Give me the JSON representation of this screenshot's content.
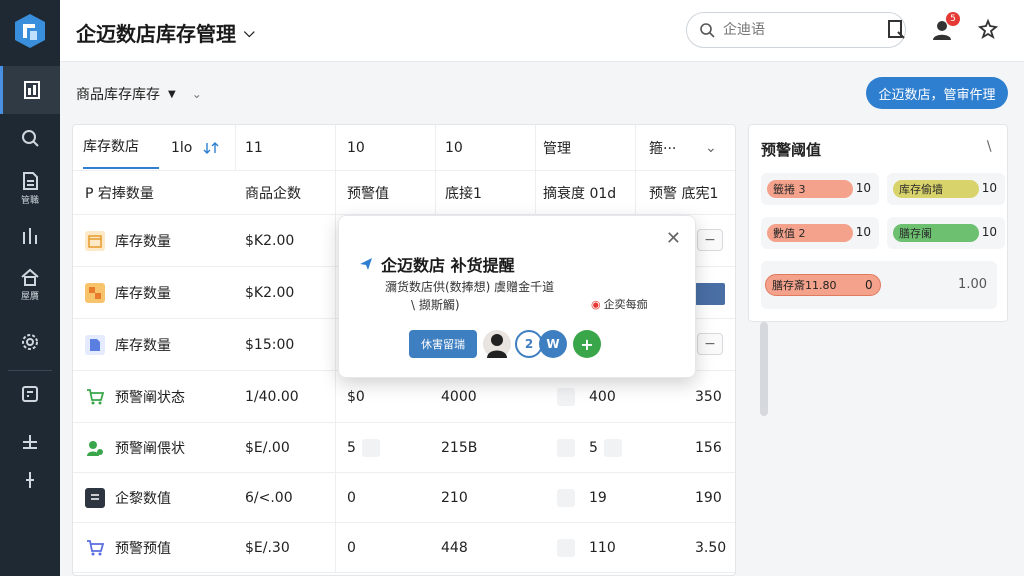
{
  "colors": {
    "accent": "#2f7fd1",
    "sidebar_bg": "#1f2933",
    "danger": "#e53935"
  },
  "header": {
    "title": "企迈数店库存管理",
    "search_placeholder": "企迪语",
    "notification_count": "5"
  },
  "sidebar": {
    "items": [
      {
        "icon": "dashboard-icon",
        "label": ""
      },
      {
        "icon": "search-icon",
        "label": ""
      },
      {
        "icon": "document-icon",
        "label": "管職"
      },
      {
        "icon": "chart-icon",
        "label": ""
      },
      {
        "icon": "home-icon",
        "label": "屋贋"
      },
      {
        "icon": "gear-icon",
        "label": ""
      },
      {
        "icon": "calculator-icon",
        "label": ""
      }
    ]
  },
  "subheader": {
    "title": "商品库存库存",
    "action_button": "企迈数店，管审仵理"
  },
  "table": {
    "tabs": [
      "库存数店",
      "1lo",
      "11",
      "10",
      "10",
      "管理",
      "箍···"
    ],
    "headers": [
      "P 宕捧数量",
      "商品企数",
      "预警值",
      "底接1",
      "摘衰度 01d",
      "预警 底宪1"
    ],
    "rows": [
      {
        "icon": "calendar-icon",
        "name": "库存数量",
        "price": "$K2.00",
        "c3": "",
        "c4": "",
        "c5": "",
        "c6": ""
      },
      {
        "icon": "boxes-icon",
        "name": "库存数量",
        "price": "$K2.00",
        "c3": "",
        "c4": "",
        "c5": "",
        "c6": ""
      },
      {
        "icon": "file-icon",
        "name": "库存数量",
        "price": "$15:00",
        "c3": "",
        "c4": "",
        "c5": "",
        "c6": ""
      },
      {
        "icon": "cart-icon",
        "name": "预警阐状态",
        "price": "1/40.00",
        "c3": "$0",
        "c4": "4000",
        "c5": "400",
        "c6": "350"
      },
      {
        "icon": "user-icon",
        "name": "预警阐偎状",
        "price": "$E/.00",
        "c3": "5",
        "c4": "215B",
        "c5": "5",
        "c6": "156"
      },
      {
        "icon": "doc-dark-icon",
        "name": "企黎数值",
        "price": "6/<.00",
        "c3": "0",
        "c4": "210",
        "c5": "19",
        "c6": "190"
      },
      {
        "icon": "cart-blue-icon",
        "name": "预警预值",
        "price": "$E/.30",
        "c3": "0",
        "c4": "448",
        "c5": "110",
        "c6": "3.50"
      }
    ]
  },
  "right_panel": {
    "title": "预警阈值",
    "pills": [
      {
        "label": "籤捲 3",
        "value": "10",
        "color": "#f4a28c"
      },
      {
        "label": "库存偷墙",
        "value": "10",
        "color": "#d8d36a"
      },
      {
        "label": "數值 2",
        "value": "10",
        "color": "#f4a28c"
      },
      {
        "label": "膳存阑",
        "value": "10",
        "color": "#6cc070"
      }
    ],
    "wide": {
      "label": "膳存斎11.80",
      "value1": "0",
      "value2": "1.00"
    }
  },
  "modal": {
    "title": "企迈数店  补货提醒",
    "description_line1": "瀰货数店供(数捧想) 虞赠金千道",
    "description_line2": "\\  撷斯觸)",
    "note": "企奕每痂",
    "button": "休害留瑞",
    "avatar_2": "2",
    "avatar_w": "W",
    "avatar_plus": "+"
  }
}
